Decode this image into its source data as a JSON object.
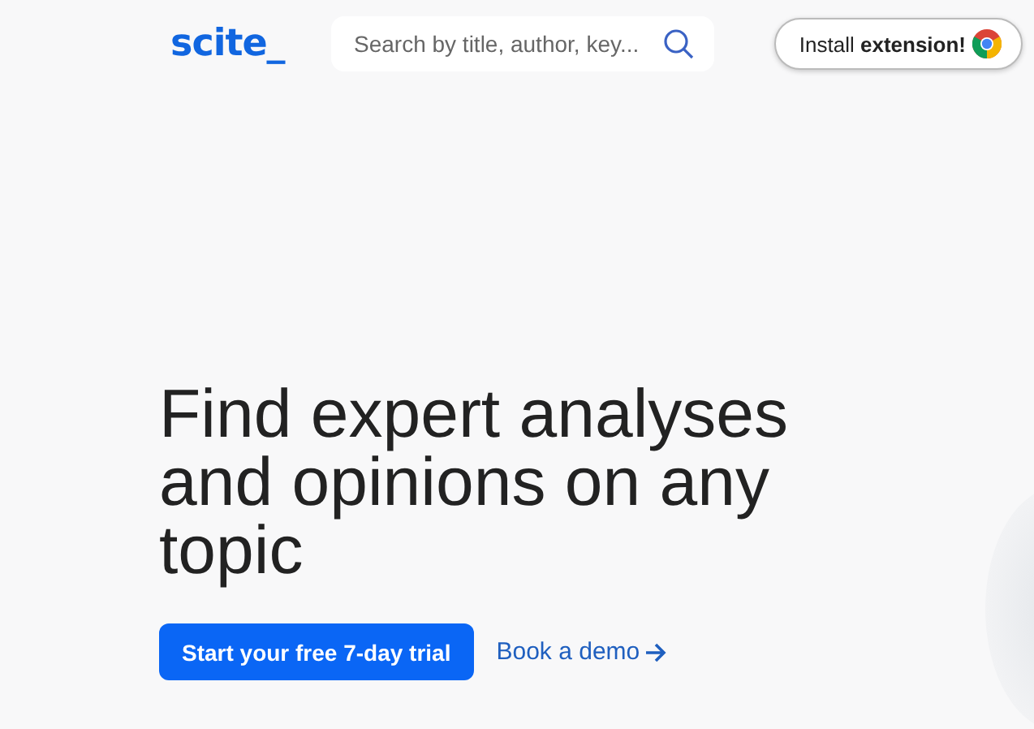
{
  "header": {
    "logo": "scite_",
    "search": {
      "placeholder": "Search by title, author, key..."
    },
    "install_button": "Install **extension!**"
  },
  "hero": {
    "headline": "Find expert analyses and opinions on any topic",
    "primary_button": "Start your free 7-day trial",
    "demo_link": "Book a demo"
  }
}
